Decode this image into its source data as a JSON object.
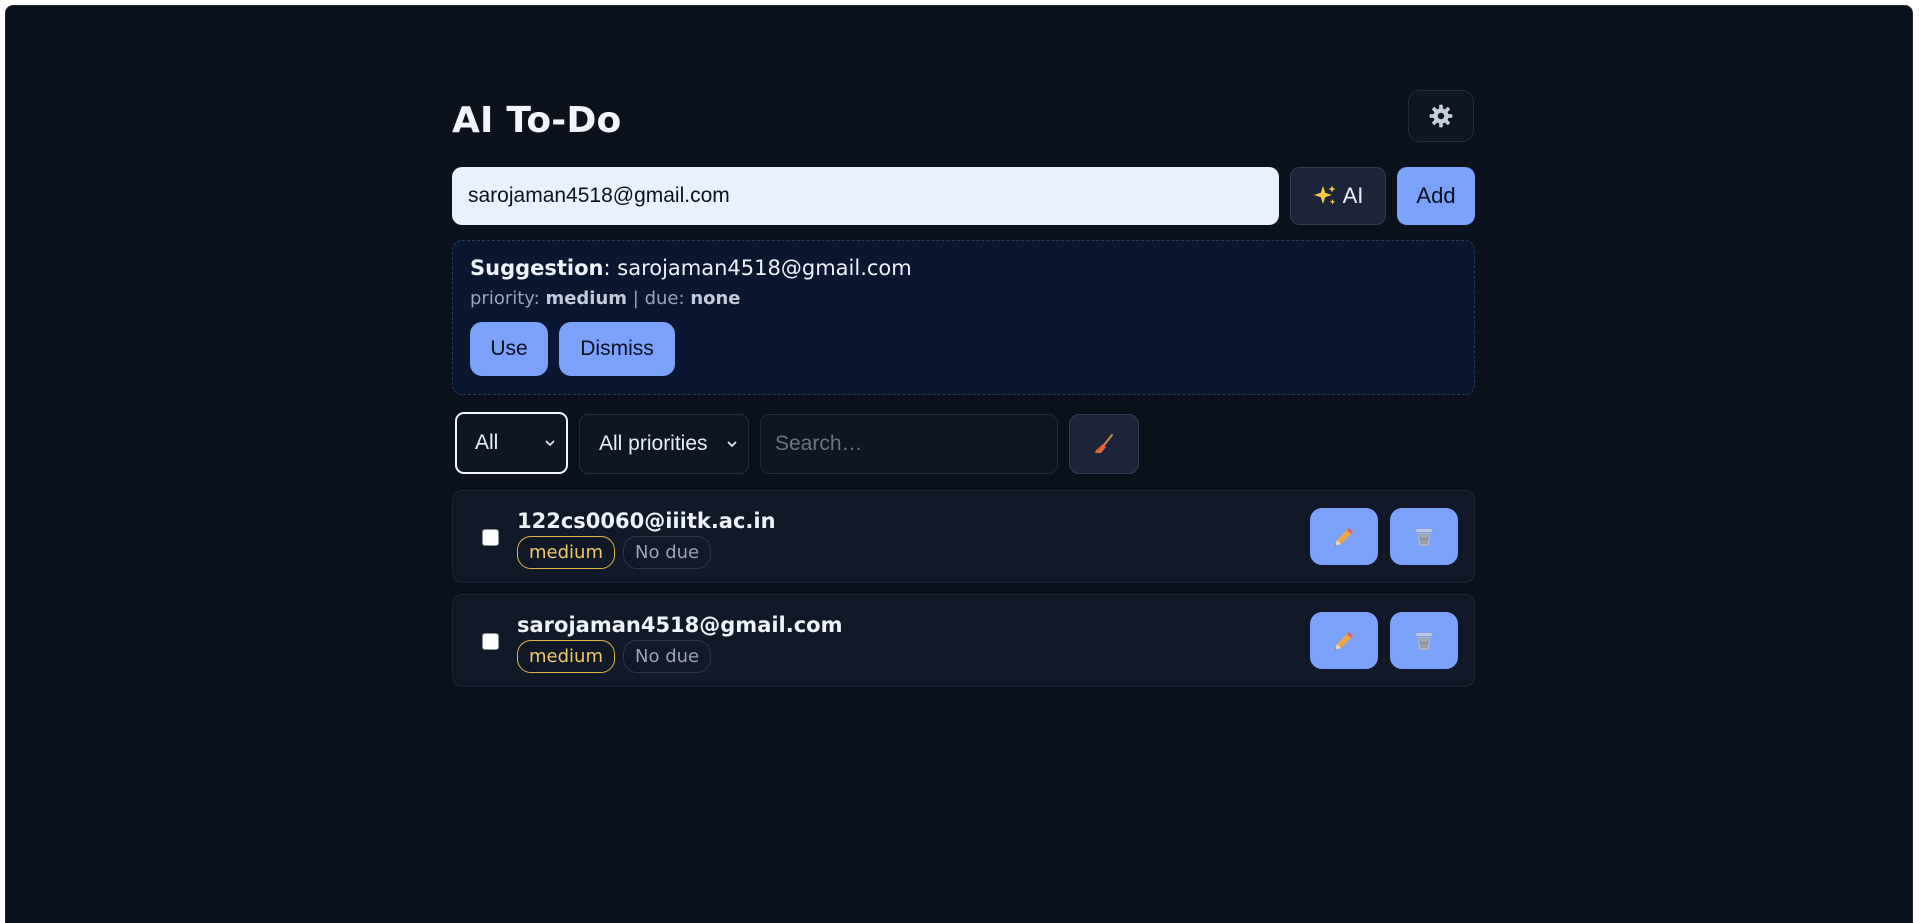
{
  "app": {
    "title": "AI To-Do"
  },
  "composer": {
    "input_value": "sarojaman4518@gmail.com",
    "ai_label": "AI",
    "add_label": "Add"
  },
  "suggestion": {
    "heading": "Suggestion",
    "text": "sarojaman4518@gmail.com",
    "priority_label": "priority:",
    "priority_value": "medium",
    "separator": "|",
    "due_label": "due:",
    "due_value": "none",
    "use_label": "Use",
    "dismiss_label": "Dismiss"
  },
  "filters": {
    "status_selected": "All",
    "priority_selected": "All priorities",
    "search_placeholder": "Search…"
  },
  "tasks": [
    {
      "title": "122cs0060@iiitk.ac.in",
      "priority": "medium",
      "due": "No due",
      "done": false
    },
    {
      "title": "sarojaman4518@gmail.com",
      "priority": "medium",
      "due": "No due",
      "done": false
    }
  ],
  "colors": {
    "background": "#0b111d",
    "accent": "#7aa2fb",
    "priority_medium": "#e0b545",
    "text": "#eef2f9"
  },
  "icons": {
    "settings": "gear-icon",
    "ai": "sparkles-icon",
    "clear": "broom-icon",
    "edit": "pencil-icon",
    "delete": "wastebasket-icon"
  }
}
